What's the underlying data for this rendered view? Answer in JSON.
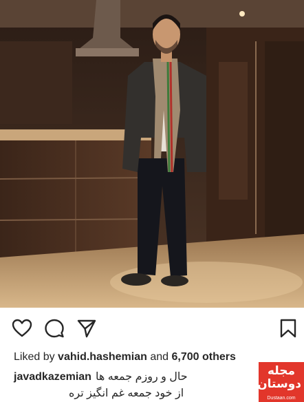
{
  "post": {
    "likes": {
      "prefix": "Liked by",
      "user": "vahid.hashemian",
      "joiner": "and",
      "count": "6,700 others"
    },
    "caption": {
      "author": "javadkazemian",
      "line1": "حال و روزم جمعه ها",
      "line2": "از خود جمعه غم انگیز تره"
    }
  },
  "icons": {
    "like": "heart-icon",
    "comment": "comment-bubble-icon",
    "share": "paper-plane-icon",
    "save": "bookmark-icon"
  },
  "watermark": {
    "brand": "مجله دوستان",
    "site": "Dustaan.com"
  }
}
